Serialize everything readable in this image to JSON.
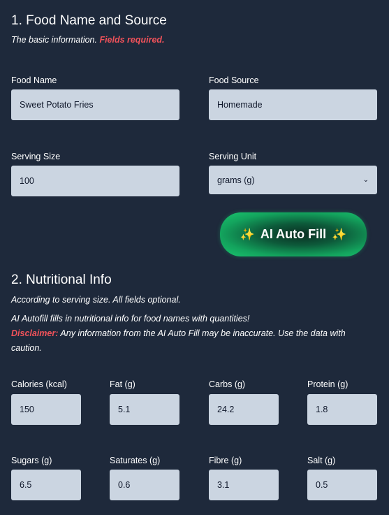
{
  "section1": {
    "title": "1. Food Name and Source",
    "desc_prefix": "The basic information. ",
    "desc_required": "Fields required."
  },
  "food_name": {
    "label": "Food Name",
    "value": "Sweet Potato Fries"
  },
  "food_source": {
    "label": "Food Source",
    "value": "Homemade"
  },
  "serving_size": {
    "label": "Serving Size",
    "value": "100"
  },
  "serving_unit": {
    "label": "Serving Unit",
    "value": "grams (g)"
  },
  "ai_button": {
    "label": "AI Auto Fill",
    "sparkle": "✨"
  },
  "section2": {
    "title": "2. Nutritional Info",
    "line1": "According to serving size. All fields optional.",
    "line2": "AI Autofill fills in nutritional info for food names with quantities!",
    "disclaimer_label": "Disclaimer:",
    "disclaimer_text": " Any information from the AI Auto Fill may be inaccurate. Use the data with caution."
  },
  "nutrients": {
    "calories": {
      "label": "Calories (kcal)",
      "value": "150"
    },
    "fat": {
      "label": "Fat (g)",
      "value": "5.1"
    },
    "carbs": {
      "label": "Carbs (g)",
      "value": "24.2"
    },
    "protein": {
      "label": "Protein (g)",
      "value": "1.8"
    },
    "sugars": {
      "label": "Sugars (g)",
      "value": "6.5"
    },
    "saturates": {
      "label": "Saturates (g)",
      "value": "0.6"
    },
    "fibre": {
      "label": "Fibre (g)",
      "value": "3.1"
    },
    "salt": {
      "label": "Salt (g)",
      "value": "0.5"
    }
  },
  "colors": {
    "background": "#1e293b",
    "field": "#cbd5e1",
    "required": "#f0525a",
    "ai_button": "#1ac66f"
  }
}
